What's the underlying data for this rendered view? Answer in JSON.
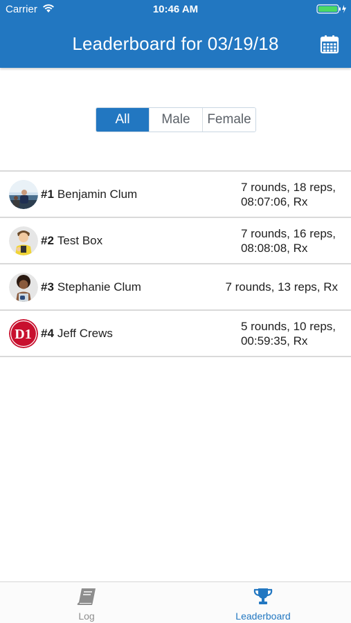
{
  "status_bar": {
    "carrier": "Carrier",
    "time": "10:46 AM"
  },
  "header": {
    "title": "Leaderboard for 03/19/18",
    "calendar_icon": "calendar-icon"
  },
  "filter": {
    "options": [
      "All",
      "Male",
      "Female"
    ],
    "selected": "All"
  },
  "leaderboard": [
    {
      "rank": "#1",
      "name": "Benjamin Clum",
      "score_line1": "7 rounds, 18 reps,",
      "score_line2": "08:07:06, Rx",
      "avatar": "photo"
    },
    {
      "rank": "#2",
      "name": "Test Box",
      "score_line1": "7 rounds, 16 reps,",
      "score_line2": "08:08:08, Rx",
      "avatar": "cartoon"
    },
    {
      "rank": "#3",
      "name": "Stephanie Clum",
      "score_line1": "7 rounds, 13 reps, Rx",
      "avatar": "cartoon"
    },
    {
      "rank": "#4",
      "name": "Jeff Crews",
      "score_line1": "5 rounds, 10 reps,",
      "score_line2": "00:59:35, Rx",
      "avatar": "logo",
      "avatar_text": "D1"
    }
  ],
  "tabs": [
    {
      "label": "Log",
      "icon": "book-icon",
      "active": false
    },
    {
      "label": "Leaderboard",
      "icon": "trophy-icon",
      "active": true
    }
  ],
  "colors": {
    "primary": "#2277c1",
    "inactive_tab": "#8d8d8d",
    "logo_red": "#c8102e"
  }
}
